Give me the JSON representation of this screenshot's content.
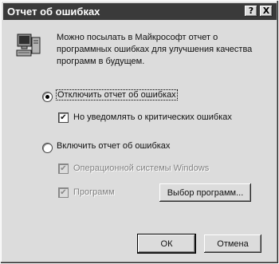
{
  "window": {
    "title": "Отчет об ошибках",
    "help_glyph": "?",
    "close_glyph": "X"
  },
  "info": {
    "icon": "computer-icon",
    "text": "Можно посылать в Майкрософт отчет о программных ошибках для улучшения качества программ в будущем."
  },
  "options": {
    "disable_report": {
      "label": "Отключить отчет об ошибках",
      "selected": true
    },
    "notify_critical": {
      "label": "Но уведомлять о критических ошибках",
      "checked": true,
      "mark": "✔"
    },
    "enable_report": {
      "label": "Включить отчет об ошибках",
      "selected": false
    },
    "os_errors": {
      "label": "Операционной системы Windows",
      "checked": true,
      "mark": "✔",
      "disabled": true
    },
    "program_errors": {
      "label": "Программ",
      "checked": true,
      "mark": "✔",
      "disabled": true
    },
    "choose_programs_label": "Выбор программ..."
  },
  "buttons": {
    "ok": "ОК",
    "cancel": "Отмена"
  }
}
